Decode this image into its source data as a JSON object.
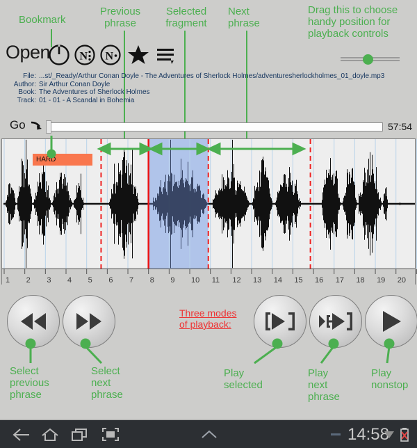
{
  "annotations": {
    "bookmark": "Bookmark",
    "previous_phrase": "Previous\nphrase",
    "selected_fragment": "Selected\nfragment",
    "next_phrase": "Next\nphrase",
    "drag_handle": "Drag this to choose\nhandy position for\nplayback controls",
    "three_modes": "Three modes\nof playback:",
    "select_previous_phrase": "Select\nprevious\nphrase",
    "select_next_phrase": "Select\nnext\nphrase",
    "play_selected": "Play\nselected",
    "play_next_phrase": "Play\nnext\nphrase",
    "play_nonstop": "Play\nnonstop",
    "color_green": "#4caf50",
    "color_red": "#ee3333"
  },
  "toolbar": {
    "open_label": "Open",
    "icons": [
      {
        "name": "power-icon",
        "label": "Power"
      },
      {
        "name": "phrase-mark-icon",
        "label": "N:"
      },
      {
        "name": "phrase-dot-icon",
        "label": "N."
      },
      {
        "name": "star-bookmark-icon",
        "label": "Star"
      },
      {
        "name": "playlist-menu-icon",
        "label": "Menu"
      }
    ],
    "drag_slider_value": 50
  },
  "meta": {
    "rows": [
      {
        "key": "File:",
        "value": "...st/_Ready/Arthur Conan Doyle - The Adventures of Sherlock Holmes/adventuresherlockholmes_01_doyle.mp3"
      },
      {
        "key": "Author:",
        "value": "Sir Arthur Conan Doyle"
      },
      {
        "key": "Book:",
        "value": "The Adventures of Sherlock Holmes"
      },
      {
        "key": "Track:",
        "value": "01 - 01 - A Scandal in Bohemia"
      }
    ]
  },
  "seek": {
    "go_label": "Go",
    "total_time": "57:54",
    "position_percent": 0
  },
  "waveform": {
    "bookmark_badge": "HARD",
    "ruler_labels": [
      "1",
      "2",
      "3",
      "4",
      "5",
      "6",
      "7",
      "8",
      "9",
      "10",
      "11",
      "12",
      "13",
      "14",
      "15",
      "16",
      "17",
      "18",
      "19",
      "20",
      "2"
    ],
    "selection_start": 8,
    "selection_end": 10.9,
    "phrase_marks": [
      5.7,
      8,
      10.9,
      15.85
    ],
    "colors": {
      "selection_fill": "#b0c4ea",
      "phrase_dashed": "#ee2222",
      "cursor_solid": "#ee1111",
      "waveform": "#111111",
      "background": "#eeeeee"
    }
  },
  "transport": {
    "buttons": [
      {
        "name": "select-previous-phrase-button",
        "icon": "rewind-icon"
      },
      {
        "name": "select-next-phrase-button",
        "icon": "fast-forward-icon"
      },
      {
        "name": "play-selected-button",
        "icon": "play-selected-icon"
      },
      {
        "name": "play-next-phrase-button",
        "icon": "play-next-phrase-icon"
      },
      {
        "name": "play-nonstop-button",
        "icon": "play-icon"
      }
    ]
  },
  "navbar": {
    "time": "14:58",
    "icons": [
      "back-icon",
      "home-icon",
      "recents-icon",
      "fullscreen-icon",
      "expand-up-icon",
      "wifi-icon",
      "battery-icon"
    ]
  }
}
